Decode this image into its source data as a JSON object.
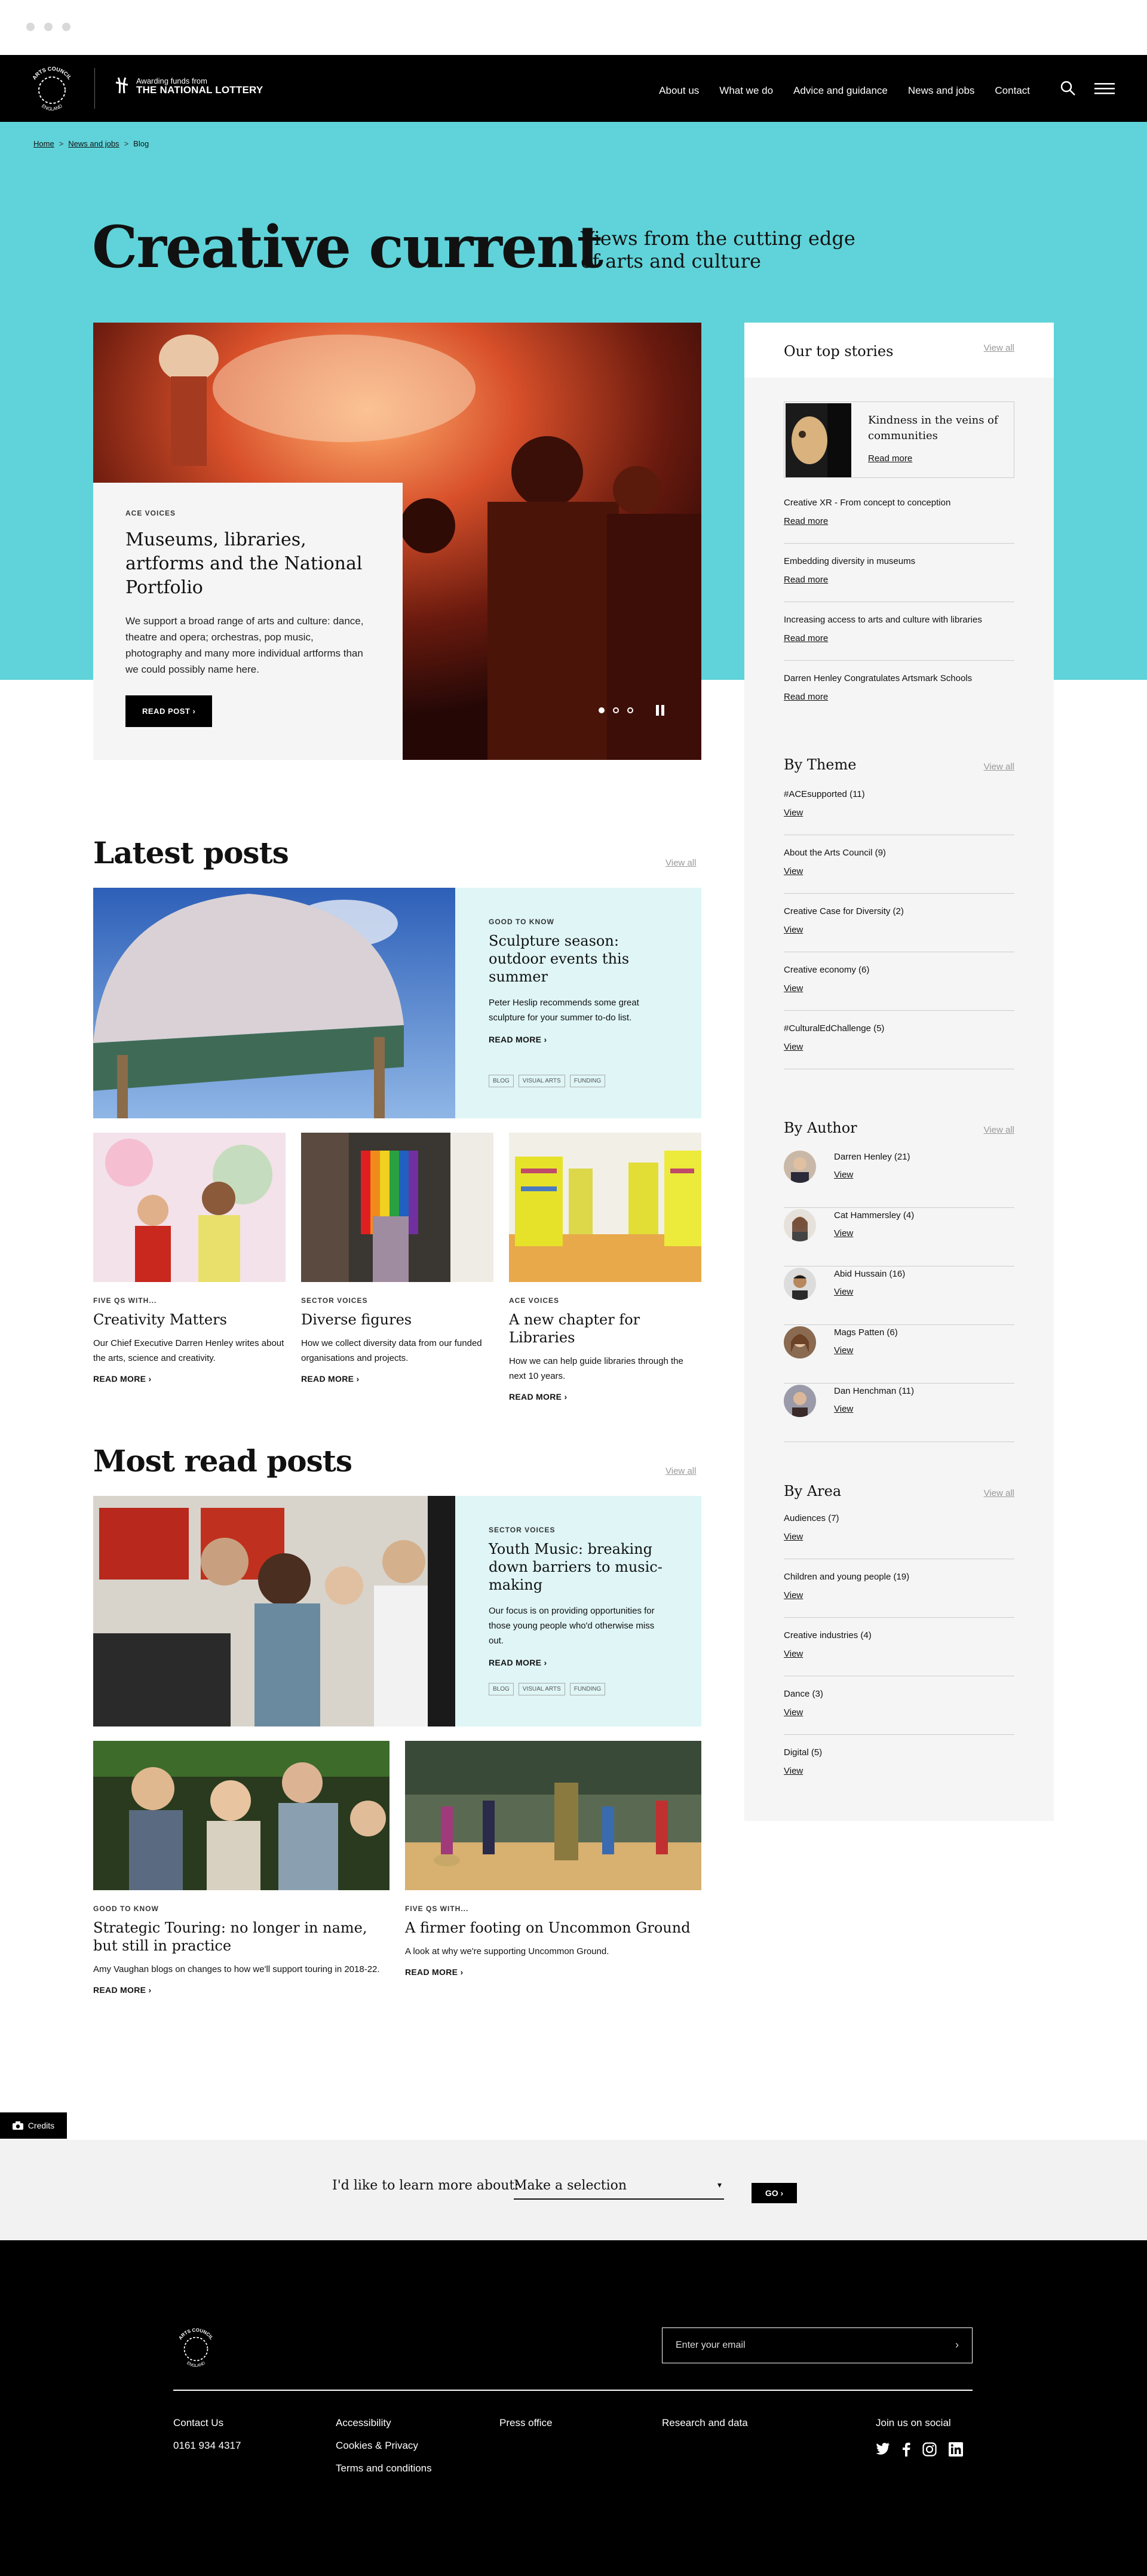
{
  "header": {
    "logo_text": "ARTS COUNCIL ENGLAND",
    "lottery_line1": "Awarding funds from",
    "lottery_line2": "THE NATIONAL LOTTERY",
    "nav": [
      "About us",
      "What we do",
      "Advice and guidance",
      "News and jobs",
      "Contact"
    ],
    "icons": [
      "search-icon",
      "menu-icon"
    ]
  },
  "breadcrumb": {
    "home": "Home",
    "news": "News and jobs",
    "current": "Blog",
    "sep": ">"
  },
  "hero": {
    "title": "Creative current",
    "subtitle": "Views from the cutting edge of arts and culture",
    "bg_color": "#5fd3d9"
  },
  "featured": {
    "eyebrow": "ACE VOICES",
    "title": "Museums, libraries, artforms and the National Portfolio",
    "text": "We support a broad range of arts and culture: dance, theatre and opera; orchestras, pop music, photography and many more individual artforms than we could possibly name here.",
    "button": "READ POST",
    "slides": 3,
    "active_slide": 1
  },
  "sidebar": {
    "top_stories": {
      "heading": "Our top stories",
      "view_all": "View all",
      "featured": {
        "title": "Kindness in the veins of communities",
        "read_more": "Read more"
      },
      "items": [
        {
          "title": "Creative XR - From concept to conception",
          "link": "Read more"
        },
        {
          "title": "Embedding diversity in museums",
          "link": "Read more"
        },
        {
          "title": "Increasing access to arts and culture with libraries",
          "link": "Read more"
        },
        {
          "title": "Darren Henley Congratulates Artsmark Schools",
          "link": "Read more"
        }
      ]
    },
    "by_theme": {
      "heading": "By Theme",
      "view_all": "View all",
      "items": [
        {
          "title": "#ACEsupported (11)",
          "link": "View"
        },
        {
          "title": "About the Arts Council (9)",
          "link": "View"
        },
        {
          "title": "Creative Case for Diversity (2)",
          "link": "View"
        },
        {
          "title": "Creative economy (6)",
          "link": "View"
        },
        {
          "title": "#CulturalEdChallenge (5)",
          "link": "View"
        }
      ]
    },
    "by_author": {
      "heading": "By Author",
      "view_all": "View all",
      "items": [
        {
          "name": "Darren Henley (21)",
          "link": "View"
        },
        {
          "name": "Cat Hammersley (4)",
          "link": "View"
        },
        {
          "name": "Abid Hussain (16)",
          "link": "View"
        },
        {
          "name": "Mags Patten (6)",
          "link": "View"
        },
        {
          "name": "Dan Henchman (11)",
          "link": "View"
        }
      ]
    },
    "by_area": {
      "heading": "By Area",
      "view_all": "View all",
      "items": [
        {
          "title": "Audiences (7)",
          "link": "View"
        },
        {
          "title": "Children and young people (19)",
          "link": "View"
        },
        {
          "title": "Creative industries (4)",
          "link": "View"
        },
        {
          "title": "Dance (3)",
          "link": "View"
        },
        {
          "title": "Digital (5)",
          "link": "View"
        }
      ]
    }
  },
  "latest": {
    "heading": "Latest posts",
    "view_all": "View all",
    "big": {
      "eyebrow": "GOOD TO KNOW",
      "title": "Sculpture season: outdoor events this summer",
      "text": "Peter Heslip recommends some great sculpture for your summer to-do list.",
      "link": "READ MORE",
      "tags": [
        "BLOG",
        "VISUAL ARTS",
        "FUNDING"
      ]
    },
    "cards": [
      {
        "eyebrow": "FIVE QS WITH...",
        "title": "Creativity Matters",
        "text": "Our Chief Executive Darren Henley writes about the arts, science and creativity.",
        "link": "READ MORE"
      },
      {
        "eyebrow": "SECTOR VOICES",
        "title": "Diverse figures",
        "text": "How we collect diversity data from our funded organisations and projects.",
        "link": "READ MORE"
      },
      {
        "eyebrow": "ACE VOICES",
        "title": "A new chapter for Libraries",
        "text": "How we can help guide libraries through the next 10 years.",
        "link": "READ MORE"
      }
    ]
  },
  "most_read": {
    "heading": "Most read posts",
    "view_all": "View all",
    "big": {
      "eyebrow": "SECTOR VOICES",
      "title": "Youth Music: breaking down barriers to music-making",
      "text": "Our focus is on providing opportunities for those young people who'd otherwise miss out.",
      "link": "READ MORE",
      "tags": [
        "BLOG",
        "VISUAL ARTS",
        "FUNDING"
      ]
    },
    "cards": [
      {
        "eyebrow": "GOOD TO KNOW",
        "title": "Strategic Touring: no longer in name, but still in practice",
        "text": "Amy Vaughan blogs on changes to how we'll support touring in 2018-22.",
        "link": "READ MORE"
      },
      {
        "eyebrow": "FIVE QS WITH...",
        "title": "A firmer footing on Uncommon Ground",
        "text": "A look at why we're supporting Uncommon Ground.",
        "link": "READ MORE"
      }
    ]
  },
  "credits": "Credits",
  "learn": {
    "question": "I'd like to learn more about:",
    "select": "Make a selection",
    "go": "GO"
  },
  "footer": {
    "email_placeholder": "Enter your email",
    "col1": [
      "Contact Us",
      "0161 934 4317"
    ],
    "col2": [
      "Accessibility",
      "Cookies & Privacy",
      "Terms and conditions"
    ],
    "col3": [
      "Press office"
    ],
    "col4": [
      "Research and data"
    ],
    "social_heading": "Join us on social",
    "social": [
      "twitter-icon",
      "facebook-icon",
      "instagram-icon",
      "linkedin-icon"
    ]
  }
}
